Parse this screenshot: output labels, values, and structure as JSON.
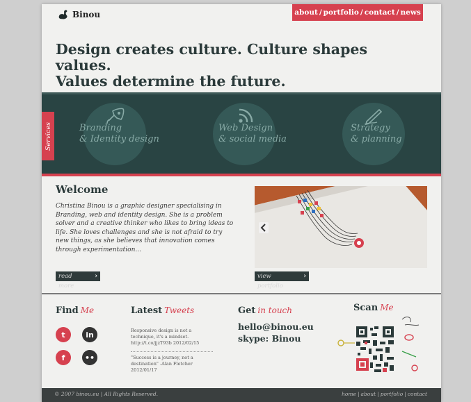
{
  "brand": {
    "name": "Binou",
    "accent": "#d6414f",
    "dark": "#294443"
  },
  "nav": {
    "items": [
      "about",
      "portfolio",
      "contact",
      "news"
    ],
    "separator": "/"
  },
  "hero": {
    "line1": "Design creates culture. Culture shapes values.",
    "line2": "Values determine the future."
  },
  "services": {
    "tab_label": "Services",
    "items": [
      {
        "line1": "Branding",
        "line2": "& Identity design",
        "icon": "rocket-icon"
      },
      {
        "line1": "Web Design",
        "line2": "& social media",
        "icon": "rss-icon"
      },
      {
        "line1": "Strategy",
        "line2": "& planning",
        "icon": "pen-icon"
      }
    ]
  },
  "welcome": {
    "title": "Welcome",
    "text": "Christina Binou is a graphic designer specialising in Branding, web and identity design. She is a problem solver and a creative thinker who likes to bring ideas to life. She loves challenges and she is not afraid to try new things, as she believes that innovation comes through experimentation...",
    "read_more": "read more",
    "view_portfolio": "view portfolio"
  },
  "find": {
    "title": "Find",
    "hand": "Me",
    "networks": [
      "t",
      "in",
      "f",
      "••"
    ]
  },
  "latest": {
    "title": "Latest",
    "hand": "Tweets",
    "tweets": [
      "Responsive design is not a technique, it's a mindset. http://t.co/jjzT93b 2012/02/15",
      "\"Success is a journey, not a destination\" -Alan Fletcher 2012/01/17"
    ]
  },
  "get": {
    "title": "Get",
    "hand": "in touch",
    "email": "hello@binou.eu",
    "skype": "skype: Binou"
  },
  "scan": {
    "title": "Scan",
    "hand": "Me"
  },
  "footer": {
    "copyright": "© 2007 binou.eu | All Rights Reserved.",
    "links": [
      "home",
      "about",
      "portfolio",
      "contact"
    ],
    "separator": "|"
  }
}
